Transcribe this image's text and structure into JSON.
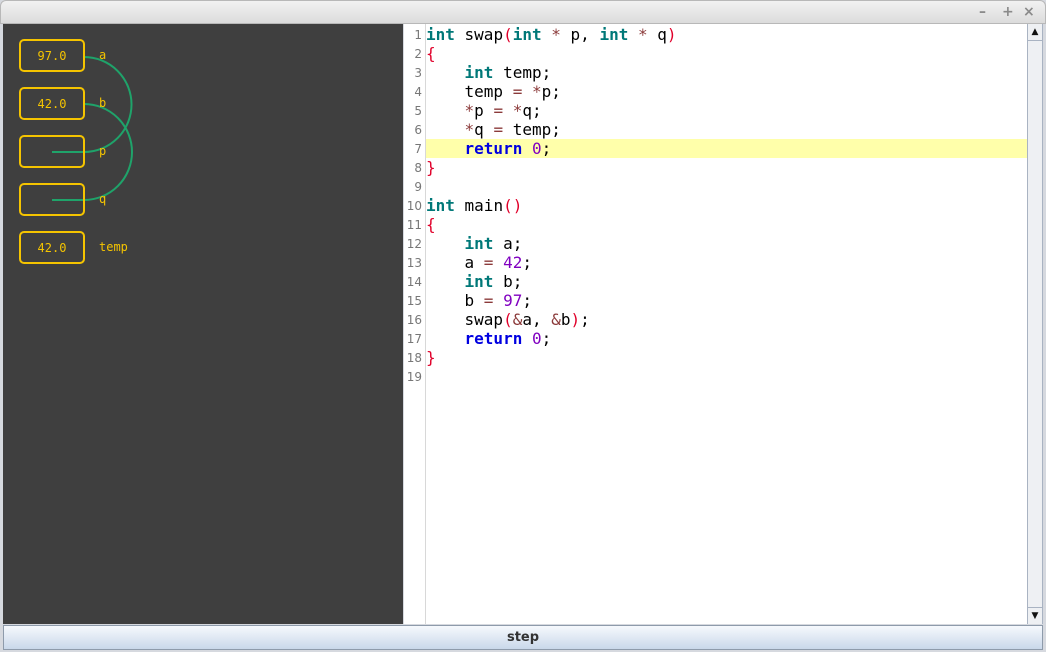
{
  "window": {
    "controls": {
      "minimize": "–",
      "maximize": "+",
      "close": "×"
    }
  },
  "variables": [
    {
      "name": "a",
      "value": "97.0"
    },
    {
      "name": "b",
      "value": "42.0"
    },
    {
      "name": "p",
      "value": ""
    },
    {
      "name": "q",
      "value": ""
    },
    {
      "name": "temp",
      "value": "42.0"
    }
  ],
  "pointers": [
    {
      "from": "p",
      "to": "a"
    },
    {
      "from": "q",
      "to": "b"
    }
  ],
  "colors": {
    "box": "#f5c400",
    "arrow": "#1fa36a",
    "panel": "#3f3f3f",
    "highlight": "#ffffaa"
  },
  "editor": {
    "highlighted_line": 7,
    "lines": [
      [
        [
          "int",
          "kw"
        ],
        [
          " swap",
          "id"
        ],
        [
          "(",
          "par"
        ],
        [
          "int",
          "kw"
        ],
        [
          " ",
          "id"
        ],
        [
          "*",
          "op"
        ],
        [
          " p, ",
          "id"
        ],
        [
          "int",
          "kw"
        ],
        [
          " ",
          "id"
        ],
        [
          "*",
          "op"
        ],
        [
          " q",
          "id"
        ],
        [
          ")",
          "par"
        ]
      ],
      [
        [
          "{",
          "par"
        ]
      ],
      [
        [
          "    ",
          "id"
        ],
        [
          "int",
          "kw"
        ],
        [
          " temp;",
          "id"
        ]
      ],
      [
        [
          "    temp ",
          "id"
        ],
        [
          "=",
          "op"
        ],
        [
          " ",
          "id"
        ],
        [
          "*",
          "op"
        ],
        [
          "p;",
          "id"
        ]
      ],
      [
        [
          "    ",
          "id"
        ],
        [
          "*",
          "op"
        ],
        [
          "p ",
          "id"
        ],
        [
          "=",
          "op"
        ],
        [
          " ",
          "id"
        ],
        [
          "*",
          "op"
        ],
        [
          "q;",
          "id"
        ]
      ],
      [
        [
          "    ",
          "id"
        ],
        [
          "*",
          "op"
        ],
        [
          "q ",
          "id"
        ],
        [
          "=",
          "op"
        ],
        [
          " temp;",
          "id"
        ]
      ],
      [
        [
          "    ",
          "id"
        ],
        [
          "return",
          "ret"
        ],
        [
          " ",
          "id"
        ],
        [
          "0",
          "num"
        ],
        [
          ";",
          "id"
        ]
      ],
      [
        [
          "}",
          "par"
        ]
      ],
      [],
      [
        [
          "int",
          "kw"
        ],
        [
          " main",
          "id"
        ],
        [
          "()",
          "par"
        ]
      ],
      [
        [
          "{",
          "par"
        ]
      ],
      [
        [
          "    ",
          "id"
        ],
        [
          "int",
          "kw"
        ],
        [
          " a;",
          "id"
        ]
      ],
      [
        [
          "    a ",
          "id"
        ],
        [
          "=",
          "op"
        ],
        [
          " ",
          "id"
        ],
        [
          "42",
          "num"
        ],
        [
          ";",
          "id"
        ]
      ],
      [
        [
          "    ",
          "id"
        ],
        [
          "int",
          "kw"
        ],
        [
          " b;",
          "id"
        ]
      ],
      [
        [
          "    b ",
          "id"
        ],
        [
          "=",
          "op"
        ],
        [
          " ",
          "id"
        ],
        [
          "97",
          "num"
        ],
        [
          ";",
          "id"
        ]
      ],
      [
        [
          "    swap",
          "id"
        ],
        [
          "(",
          "par"
        ],
        [
          "&",
          "op"
        ],
        [
          "a, ",
          "id"
        ],
        [
          "&",
          "op"
        ],
        [
          "b",
          "id"
        ],
        [
          ")",
          "par"
        ],
        [
          ";",
          "id"
        ]
      ],
      [
        [
          "    ",
          "id"
        ],
        [
          "return",
          "ret"
        ],
        [
          " ",
          "id"
        ],
        [
          "0",
          "num"
        ],
        [
          ";",
          "id"
        ]
      ],
      [
        [
          "}",
          "par"
        ]
      ],
      []
    ]
  },
  "step_button": {
    "label": "step"
  }
}
